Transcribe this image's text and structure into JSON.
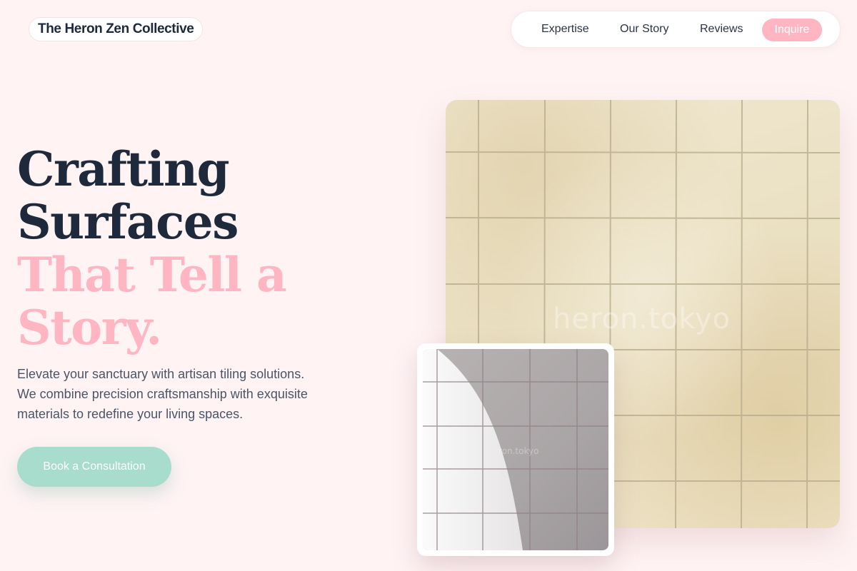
{
  "brand": {
    "name": "The Heron Zen Collective"
  },
  "nav": {
    "links": [
      "Expertise",
      "Our Story",
      "Reviews"
    ],
    "cta": "Inquire"
  },
  "hero": {
    "headline_dark": [
      "Crafting",
      "Surfaces"
    ],
    "headline_accent": [
      "That Tell a",
      "Story."
    ],
    "lead": [
      "Elevate your sanctuary with artisan tiling solutions.",
      "We combine precision craftsmanship with exquisite",
      "materials to redefine your living spaces."
    ],
    "cta": "Book a Consultation"
  },
  "images": {
    "main_watermark": "heron.tokyo",
    "secondary_watermark": "ron.tokyo"
  },
  "colors": {
    "background": "#fff3f4",
    "text_dark": "#1e2a3b",
    "accent_pink": "#ffb5c2",
    "accent_mint": "#a8dccd"
  }
}
